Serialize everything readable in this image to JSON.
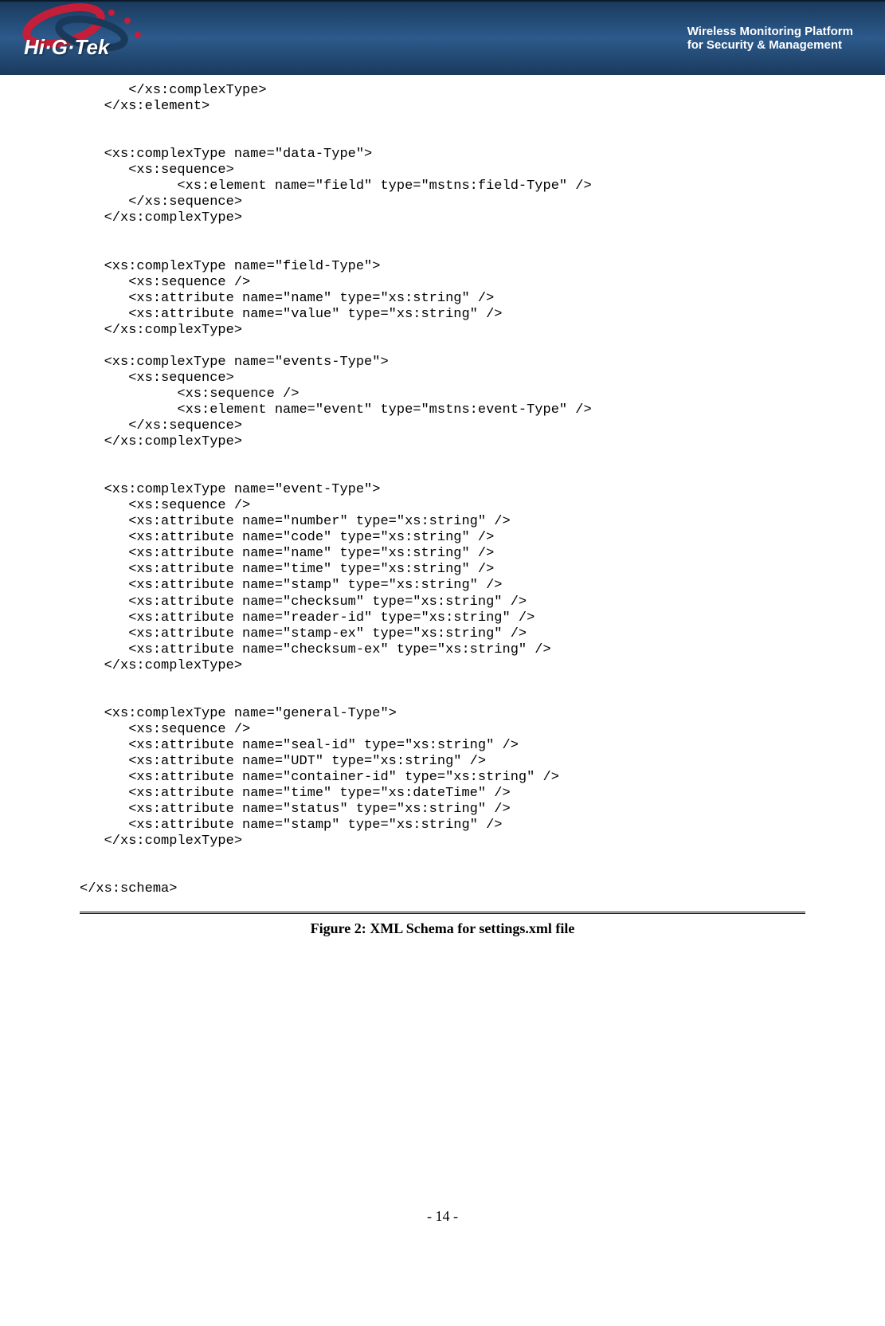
{
  "header": {
    "logo_text": "Hi·G·Tek",
    "tagline_line1": "Wireless Monitoring Platform",
    "tagline_line2": "for Security & Management"
  },
  "code": "      </xs:complexType>\n   </xs:element>\n\n\n   <xs:complexType name=\"data-Type\">\n      <xs:sequence>\n            <xs:element name=\"field\" type=\"mstns:field-Type\" />\n      </xs:sequence>\n   </xs:complexType>\n\n\n   <xs:complexType name=\"field-Type\">\n      <xs:sequence />\n      <xs:attribute name=\"name\" type=\"xs:string\" />\n      <xs:attribute name=\"value\" type=\"xs:string\" />\n   </xs:complexType>\n\n   <xs:complexType name=\"events-Type\">\n      <xs:sequence>\n            <xs:sequence />\n            <xs:element name=\"event\" type=\"mstns:event-Type\" />\n      </xs:sequence>\n   </xs:complexType>\n\n\n   <xs:complexType name=\"event-Type\">\n      <xs:sequence />\n      <xs:attribute name=\"number\" type=\"xs:string\" />\n      <xs:attribute name=\"code\" type=\"xs:string\" />\n      <xs:attribute name=\"name\" type=\"xs:string\" />\n      <xs:attribute name=\"time\" type=\"xs:string\" />\n      <xs:attribute name=\"stamp\" type=\"xs:string\" />\n      <xs:attribute name=\"checksum\" type=\"xs:string\" />\n      <xs:attribute name=\"reader-id\" type=\"xs:string\" />\n      <xs:attribute name=\"stamp-ex\" type=\"xs:string\" />\n      <xs:attribute name=\"checksum-ex\" type=\"xs:string\" />\n   </xs:complexType>\n\n\n   <xs:complexType name=\"general-Type\">\n      <xs:sequence />\n      <xs:attribute name=\"seal-id\" type=\"xs:string\" />\n      <xs:attribute name=\"UDT\" type=\"xs:string\" />\n      <xs:attribute name=\"container-id\" type=\"xs:string\" />\n      <xs:attribute name=\"time\" type=\"xs:dateTime\" />\n      <xs:attribute name=\"status\" type=\"xs:string\" />\n      <xs:attribute name=\"stamp\" type=\"xs:string\" />\n   </xs:complexType>\n\n\n</xs:schema>",
  "figure_caption": "Figure 2:  XML Schema for settings.xml file",
  "page_number": "- 14 -"
}
